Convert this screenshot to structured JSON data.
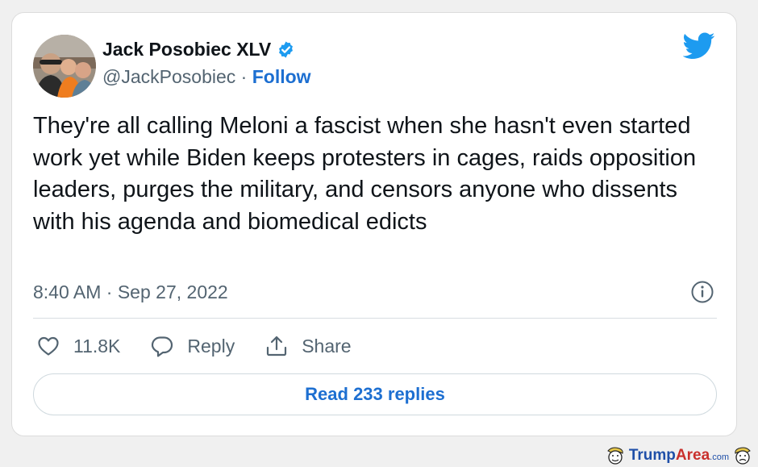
{
  "author": {
    "name": "Jack Posobiec XLV",
    "handle": "@JackPosobiec",
    "separator": "·",
    "follow_label": "Follow"
  },
  "tweet": {
    "text": "They're all calling Meloni a fascist when she hasn't even started work yet while Biden keeps protesters in cages, raids opposition leaders, purges the military, and censors anyone who dissents with his agenda and biomedical edicts",
    "time": "8:40 AM",
    "date": "Sep 27, 2022",
    "timestamp_separator": "·"
  },
  "actions": {
    "likes": "11.8K",
    "reply_label": "Reply",
    "share_label": "Share"
  },
  "replies_button": "Read 233 replies",
  "watermark": {
    "part1": "Trump",
    "part2": "Area",
    "part3": ".com"
  },
  "colors": {
    "link": "#1d6fd1",
    "twitter_blue": "#1d9bf0",
    "text": "#0f1419",
    "muted": "#536471"
  },
  "icons": [
    "verified-badge-icon",
    "twitter-bird-icon",
    "info-icon",
    "heart-icon",
    "reply-bubble-icon",
    "share-icon"
  ]
}
